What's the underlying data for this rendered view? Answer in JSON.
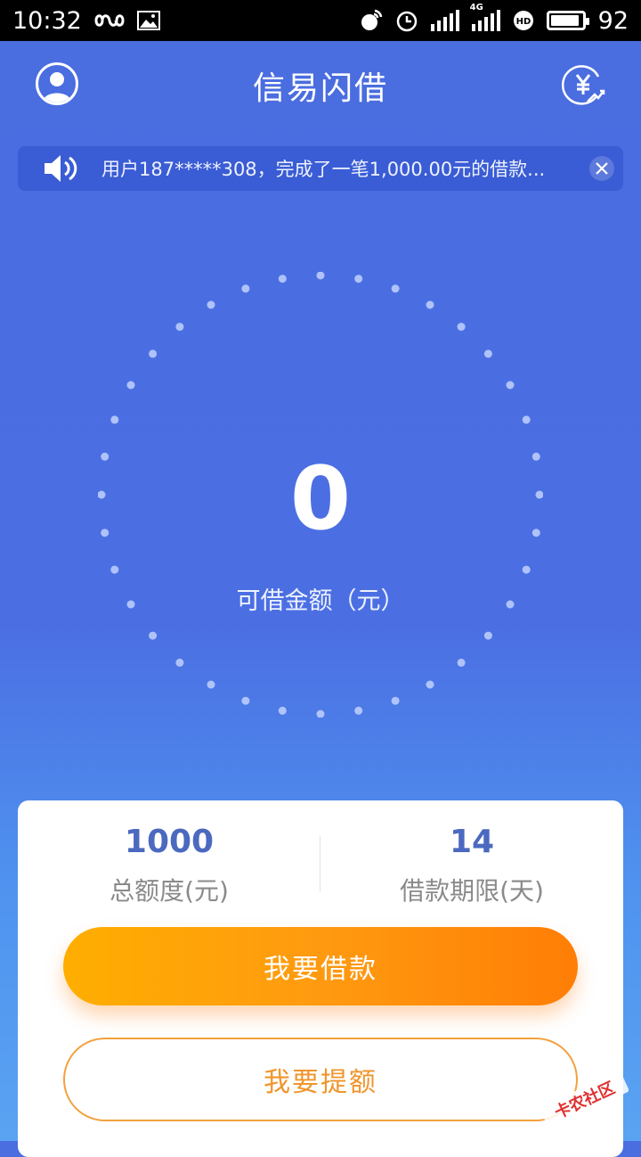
{
  "status_bar": {
    "time": "10:32",
    "battery": "92",
    "battery_level": 0.92,
    "network": "4G"
  },
  "header": {
    "title": "信易闪借"
  },
  "notice": {
    "text": "用户187*****308，完成了一笔1,000.00元的借款..."
  },
  "dial": {
    "amount": "0",
    "label": "可借金额（元）"
  },
  "stats": [
    {
      "value": "1000",
      "label": "总额度(元)"
    },
    {
      "value": "14",
      "label": "借款期限(天)"
    }
  ],
  "buttons": {
    "borrow": "我要借款",
    "raise": "我要提额"
  },
  "watermark": {
    "text": "卡农社区"
  },
  "colors": {
    "primary": "#4a6de0",
    "orange": "#ff9a10",
    "stat_blue": "#4b69bf"
  }
}
